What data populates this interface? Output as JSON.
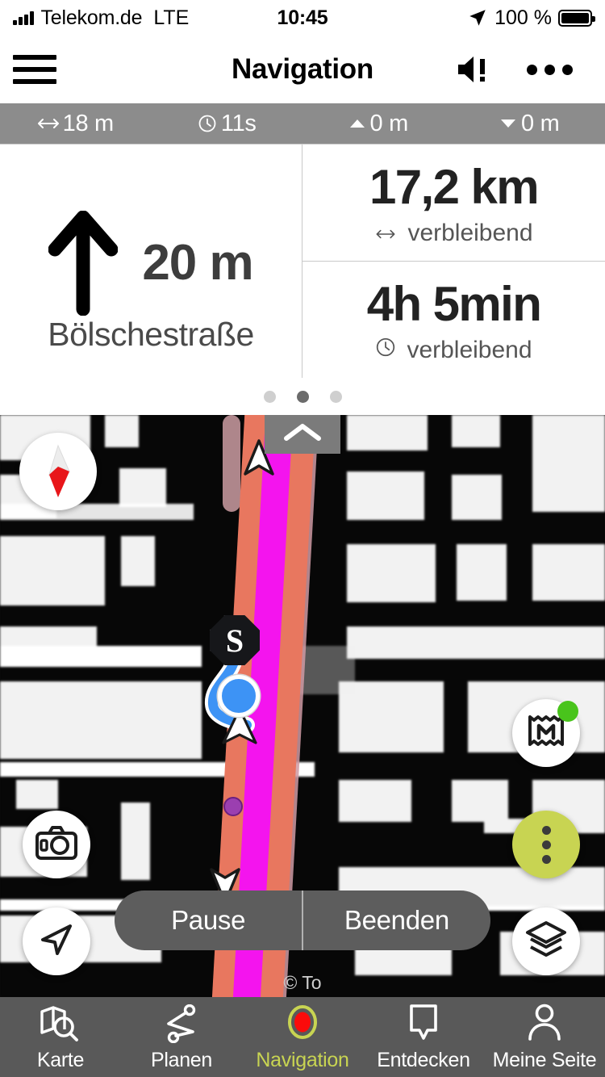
{
  "status_bar": {
    "carrier": "Telekom.de",
    "network": "LTE",
    "time": "10:45",
    "battery_percent": "100 %",
    "signal_icon": "signal-bars-icon",
    "location_icon": "location-arrow-icon",
    "battery_icon": "battery-full-icon"
  },
  "app_bar": {
    "title": "Navigation",
    "menu_icon": "hamburger-menu-icon",
    "sound_icon": "speaker-alert-icon",
    "more_icon": "more-horizontal-icon"
  },
  "metrics_strip": [
    {
      "icon": "horizontal-arrows-icon",
      "value": "18 m"
    },
    {
      "icon": "clock-icon",
      "value": "11s"
    },
    {
      "icon": "triangle-up-icon",
      "value": "0 m"
    },
    {
      "icon": "triangle-down-icon",
      "value": "0 m"
    }
  ],
  "guidance": {
    "maneuver_icon": "arrow-straight-up-icon",
    "distance": "20 m",
    "street": "Bölschestraße",
    "remaining_distance": {
      "value": "17,2 km",
      "icon": "horizontal-arrows-icon",
      "label": "verbleibend"
    },
    "remaining_time": {
      "value": "4h 5min",
      "icon": "clock-icon",
      "label": "verbleibend"
    }
  },
  "pager": {
    "count": 3,
    "active_index": 1
  },
  "map": {
    "handle_icon": "chevron-up-icon",
    "compass_icon": "compass-icon",
    "camera_icon": "camera-icon",
    "locate_icon": "navigation-arrow-icon",
    "guidebook_icon": "map-book-icon",
    "overflow_icon": "more-vertical-icon",
    "layers_icon": "map-layers-icon",
    "start_marker_label": "S",
    "position_marker_icon": "current-position-dot",
    "direction_marker_icon": "direction-arrow-icon",
    "waypoint_icon": "waypoint-dot-icon",
    "attribution": "© To",
    "accent_color": "#c8d452",
    "badge_color": "#49c41c",
    "route_core_color": "#f414ee",
    "route_casing_color": "#e8775f"
  },
  "action_bar": {
    "pause_label": "Pause",
    "stop_label": "Beenden"
  },
  "tab_bar": {
    "active_index": 2,
    "items": [
      {
        "label": "Karte",
        "icon": "map-search-icon"
      },
      {
        "label": "Planen",
        "icon": "route-plan-icon"
      },
      {
        "label": "Navigation",
        "icon": "record-navigation-icon"
      },
      {
        "label": "Entdecken",
        "icon": "map-pin-icon"
      },
      {
        "label": "Meine Seite",
        "icon": "person-icon"
      }
    ]
  }
}
